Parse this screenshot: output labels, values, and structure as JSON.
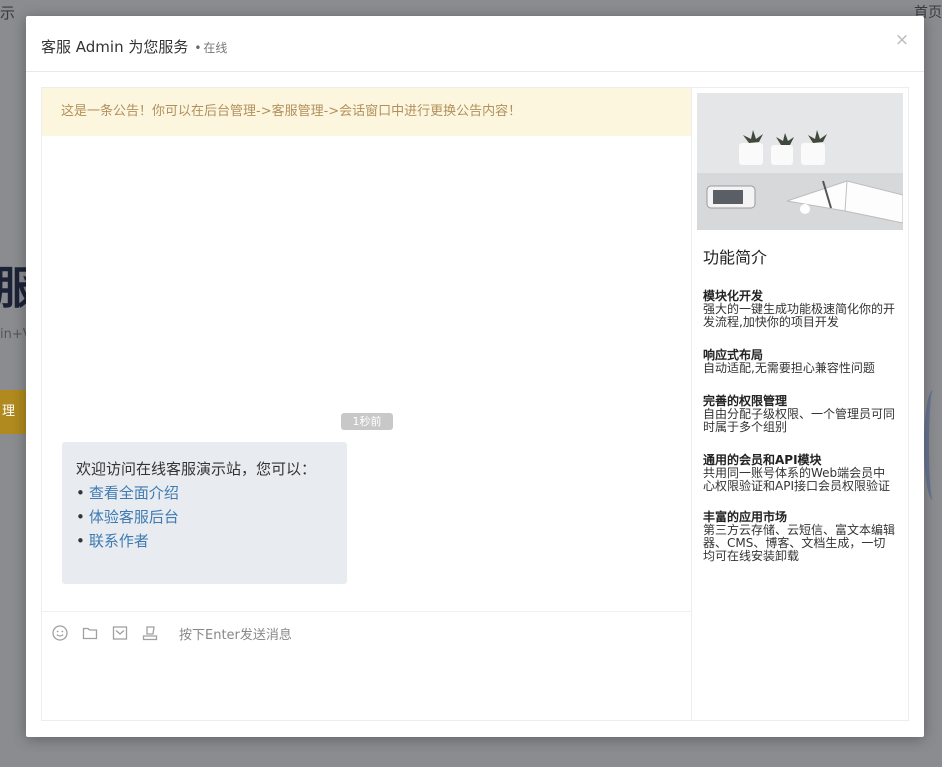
{
  "background": {
    "left_top_text": "示",
    "right_top_text": "首页",
    "big_text": "服系",
    "small_text": "in+V",
    "button_text": "理"
  },
  "modal": {
    "title": "客服 Admin 为您服务",
    "dot": "•",
    "status": "在线",
    "close_label": "×"
  },
  "notice": "这是一条公告！你可以在后台管理->客服管理->会话窗口中进行更换公告内容！",
  "message": {
    "time": "1秒前",
    "intro": "欢迎访问在线客服演示站，您可以：",
    "bullet": "•",
    "links": [
      "查看全面介绍",
      "体验客服后台",
      "联系作者"
    ]
  },
  "toolbar": {
    "icons": [
      "smile-icon",
      "folder-icon",
      "image-icon",
      "evaluate-icon"
    ],
    "input_placeholder": "按下Enter发送消息"
  },
  "sidebar": {
    "title": "功能简介",
    "features": [
      {
        "name": "模块化开发",
        "desc": "强大的一键生成功能极速简化你的开发流程,加快你的项目开发"
      },
      {
        "name": "响应式布局",
        "desc": "自动适配,无需要担心兼容性问题"
      },
      {
        "name": "完善的权限管理",
        "desc": "自由分配子级权限、一个管理员可同时属于多个组别"
      },
      {
        "name": "通用的会员和API模块",
        "desc": "共用同一账号体系的Web端会员中心权限验证和API接口会员权限验证"
      },
      {
        "name": "丰富的应用市场",
        "desc": "第三方云存储、云短信、富文本编辑器、CMS、博客、文档生成，一切均可在线安装卸载"
      }
    ]
  }
}
